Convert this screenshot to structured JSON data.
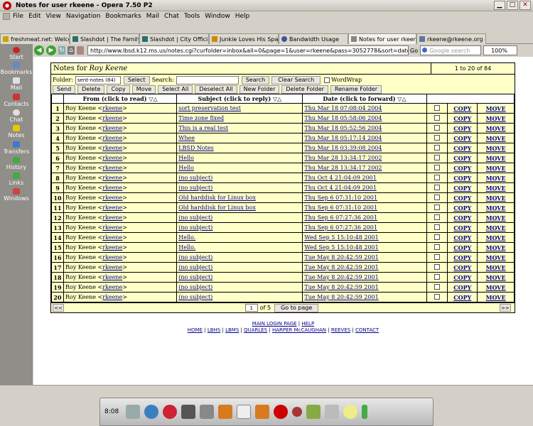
{
  "window": {
    "title": "Notes for user rkeene - Opera 7.50 P2"
  },
  "menu": [
    "File",
    "Edit",
    "View",
    "Navigation",
    "Bookmarks",
    "Mail",
    "Chat",
    "Tools",
    "Window",
    "Help"
  ],
  "tabs": [
    {
      "label": "freshmeat.net: Welcome...",
      "color": "#c9a400"
    },
    {
      "label": "Slashdot | The Family ...",
      "color": "#2b6e6e"
    },
    {
      "label": "Slashdot | City Officials...",
      "color": "#2b6e6e"
    },
    {
      "label": "Junkie Loves His Spam",
      "color": "#d08a00"
    },
    {
      "label": "Bandwidth Usage",
      "color": "#3a56a0"
    },
    {
      "label": "Notes for user rkeene",
      "color": "#888888",
      "active": true
    },
    {
      "label": "rkeene@rkeene.org - 1...",
      "color": "#5a7a9a"
    }
  ],
  "address": {
    "url": "http://www.lbsd.k12.ms.us/notes.cgi?curfolder=inbox&all=0&page=1&user=rkeene&pass=3052778&sort=datedown&folder=sent-notes&",
    "go": "Go",
    "search_placeholder": "Google search",
    "zoom": "100%"
  },
  "panel": [
    {
      "label": "Start",
      "color": "#cc2222"
    },
    {
      "label": "Bookmarks",
      "color": "#6688cc"
    },
    {
      "label": "Mail",
      "color": "#e0e0e0"
    },
    {
      "label": "Contacts",
      "color": "#cc3333"
    },
    {
      "label": "Chat",
      "color": "#e0e0e0"
    },
    {
      "label": "Notes",
      "color": "#e8c800"
    },
    {
      "label": "Transfers",
      "color": "#4477cc"
    },
    {
      "label": "History",
      "color": "#44aa44"
    },
    {
      "label": "Links",
      "color": "#44aa44"
    },
    {
      "label": "Windows",
      "color": "#cc4444"
    }
  ],
  "app": {
    "heading_prefix": "Notes for",
    "heading_name": "Roy Keene",
    "range": "1 to 20 of 84",
    "folder_label": "Folder:",
    "folder_value": "sent-notes (84)",
    "select_btn": "Select",
    "search_label": "Search:",
    "search_btn": "Search",
    "clear_btn": "Clear Search",
    "wordwrap": "WordWrap",
    "actions": [
      "Send",
      "Delete",
      "Copy",
      "Move",
      "Select All",
      "Deselect All",
      "New Folder",
      "Delete Folder",
      "Rename Folder"
    ],
    "columns": {
      "from": "From (click to read) ▽△",
      "subject": "Subject (click to reply) ▽△",
      "date": "Date (click to forward) ▽△"
    },
    "copy_label": "COPY",
    "move_label": "MOVE",
    "rows": [
      {
        "n": "1",
        "from_name": "Roy Keene <",
        "from_user": "rkeene",
        "subject": "sort preservation test",
        "date": "Thu Mar 18 07:08:04 2004"
      },
      {
        "n": "2",
        "from_name": "Roy Keene <",
        "from_user": "rkeene",
        "subject": "Time zone fixed",
        "date": "Thu Mar 18 05:58:06 2004"
      },
      {
        "n": "3",
        "from_name": "Roy Keene <",
        "from_user": "rkeene",
        "subject": "This is a real test",
        "date": "Thu Mar 18 05:52:56 2004"
      },
      {
        "n": "4",
        "from_name": "Roy Keene <",
        "from_user": "rkeene",
        "subject": "Whee",
        "date": "Thu Mar 18 05:17:14 2004"
      },
      {
        "n": "5",
        "from_name": "Roy Keene <",
        "from_user": "rkeene",
        "subject": "LBSD Notes",
        "date": "Thu Mar 18 03:39:08 2004"
      },
      {
        "n": "6",
        "from_name": "Roy Keene <",
        "from_user": "rkeene",
        "subject": "Hello",
        "date": "Thu Mar 28 13:34:17 2002"
      },
      {
        "n": "7",
        "from_name": "Roy Keene <",
        "from_user": "rkeene",
        "subject": "Hello",
        "date": "Thu Mar 28 13:34:17 2002"
      },
      {
        "n": "8",
        "from_name": "Roy Keene <",
        "from_user": "rkeene",
        "subject": "(no subject)",
        "date": "Thu Oct 4 21:04:09 2001"
      },
      {
        "n": "9",
        "from_name": "Roy Keene <",
        "from_user": "rkeene",
        "subject": "(no subject)",
        "date": "Thu Oct 4 21:04:09 2001"
      },
      {
        "n": "10",
        "from_name": "Roy Keene <",
        "from_user": "rkeene",
        "subject": "Old harddisk for Linux box",
        "date": "Thu Sep 6 07:31:10 2001"
      },
      {
        "n": "11",
        "from_name": "Roy Keene <",
        "from_user": "rkeene",
        "subject": "Old harddisk for Linux box",
        "date": "Thu Sep 6 07:31:10 2001"
      },
      {
        "n": "12",
        "from_name": "Roy Keene <",
        "from_user": "rkeene",
        "subject": "(no subject)",
        "date": "Thu Sep 6 07:27:36 2001"
      },
      {
        "n": "13",
        "from_name": "Roy Keene <",
        "from_user": "rkeene",
        "subject": "(no subject)",
        "date": "Thu Sep 6 07:27:36 2001"
      },
      {
        "n": "14",
        "from_name": "Roy Keene <",
        "from_user": "rkeene",
        "subject": "Hello.",
        "date": "Wed Sep 5 15:10:48 2001"
      },
      {
        "n": "15",
        "from_name": "Roy Keene <",
        "from_user": "rkeene",
        "subject": "Hello.",
        "date": "Wed Sep 5 15:10:48 2001"
      },
      {
        "n": "16",
        "from_name": "Roy Keene <",
        "from_user": "rkeene",
        "subject": "(no subject)",
        "date": "Tue May 8 20:42:59 2001"
      },
      {
        "n": "17",
        "from_name": "Roy Keene <",
        "from_user": "rkeene",
        "subject": "(no subject)",
        "date": "Tue May 8 20:42:59 2001"
      },
      {
        "n": "18",
        "from_name": "Roy Keene <",
        "from_user": "rkeene",
        "subject": "(no subject)",
        "date": "Tue May 8 20:42:59 2001"
      },
      {
        "n": "19",
        "from_name": "Roy Keene <",
        "from_user": "rkeene",
        "subject": "(no subject)",
        "date": "Tue May 8 20:42:59 2001"
      },
      {
        "n": "20",
        "from_name": "Roy Keene <",
        "from_user": "rkeene",
        "subject": "(no subject)",
        "date": "Tue May 8 20:42:59 2001"
      }
    ],
    "pager": {
      "prev": "<<",
      "next": ">>",
      "page": "1",
      "of": "of 5",
      "goto": "Go to page"
    }
  },
  "footer": {
    "line1": [
      "MAIN LOGIN PAGE",
      "HELP"
    ],
    "line2": [
      "HOME",
      "LBHS",
      "LBMS",
      "QUARLES",
      "HARPER McCAUGHAN",
      "REEVES",
      "CONTACT"
    ]
  },
  "taskbar": {
    "clock": "8:08"
  },
  "colors": {
    "row_bg": "#ffffc8",
    "link": "#00008b",
    "panel": "#8f8e89"
  }
}
